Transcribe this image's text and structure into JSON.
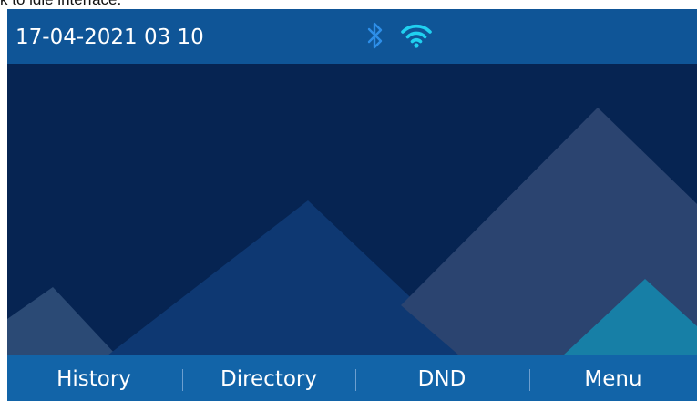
{
  "caption": "k to idle interface.",
  "status_bar": {
    "datetime": "17-04-2021 03 10",
    "icons": [
      "bluetooth-icon",
      "wifi-icon"
    ],
    "bluetooth_color": "#2d8ee8",
    "wifi_color": "#20d0f0"
  },
  "softkeys": [
    {
      "label": "History"
    },
    {
      "label": "Directory"
    },
    {
      "label": "DND"
    },
    {
      "label": "Menu"
    }
  ],
  "colors": {
    "status_bar_bg": "#0f5597",
    "wallpaper_bg": "#0a2855",
    "softkey_bar_bg": "#1264a8",
    "text": "#ffffff"
  }
}
